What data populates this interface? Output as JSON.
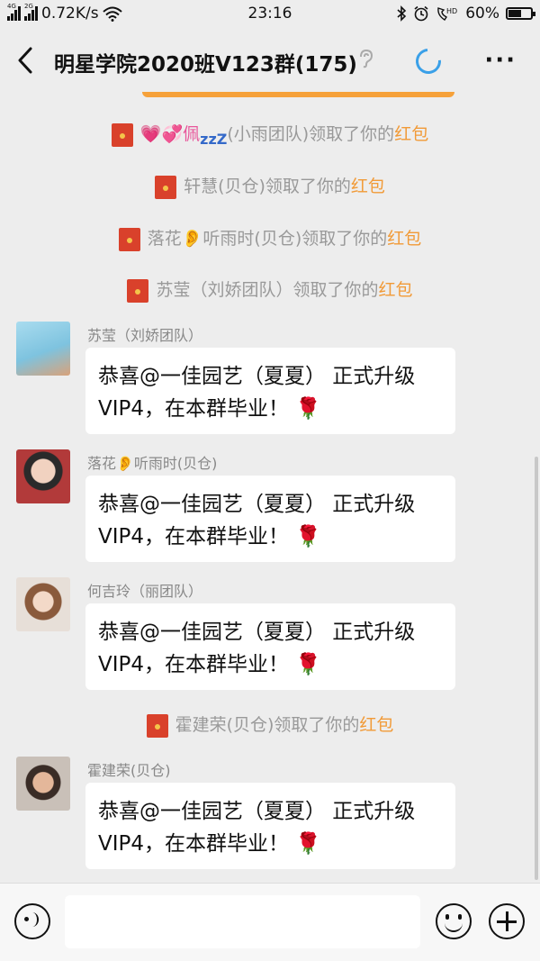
{
  "status_bar": {
    "network1": "4G",
    "network2": "2G",
    "speed": "0.72K/s",
    "time": "23:16",
    "icons": [
      "bluetooth-icon",
      "alarm-icon",
      "hd-call-icon"
    ],
    "battery_text": "60%",
    "battery_level": 0.6
  },
  "header": {
    "title": "明星学院2020班V123群(175)",
    "ear_icon": "ear-icon",
    "more_glyph": "···"
  },
  "system_messages": [
    {
      "prefix": "💗💞佩",
      "zzz": "zzZ",
      "text": "(小雨团队)领取了你的",
      "highlight": "红包"
    },
    {
      "text": "轩慧(贝仓)领取了你的",
      "highlight": "红包"
    },
    {
      "prefix": "落花👂听雨时",
      "text": "(贝仓)领取了你的",
      "highlight": "红包"
    },
    {
      "text": "苏莹（刘娇团队）领取了你的",
      "highlight": "红包"
    },
    {
      "text": "霍建荣(贝仓)领取了你的",
      "highlight": "红包"
    }
  ],
  "messages": [
    {
      "sender": "苏莹（刘娇团队）",
      "line1": "恭喜@一佳园艺（夏夏） 正式升级",
      "line2": "VIP4，在本群毕业！",
      "emoji": "🌹",
      "avatar_color": "#7ec3df"
    },
    {
      "sender": "落花👂听雨时(贝仓)",
      "line1": "恭喜@一佳园艺（夏夏） 正式升级",
      "line2": "VIP4，在本群毕业！",
      "emoji": "🌹",
      "avatar_color": "#b23a3a"
    },
    {
      "sender": "何吉玲（丽团队）",
      "line1": "恭喜@一佳园艺（夏夏） 正式升级",
      "line2": "VIP4，在本群毕业！",
      "emoji": "🌹",
      "avatar_color": "#d8b7a0"
    },
    {
      "sender": "霍建荣(贝仓)",
      "line1": "恭喜@一佳园艺（夏夏） 正式升级",
      "line2": "VIP4，在本群毕业！",
      "emoji": "🌹",
      "avatar_color": "#5a4a42"
    }
  ],
  "colors": {
    "background": "#ededed",
    "highlight": "#f19a37",
    "red_envelope": "#d9412b",
    "loader": "#3aa0e8"
  }
}
